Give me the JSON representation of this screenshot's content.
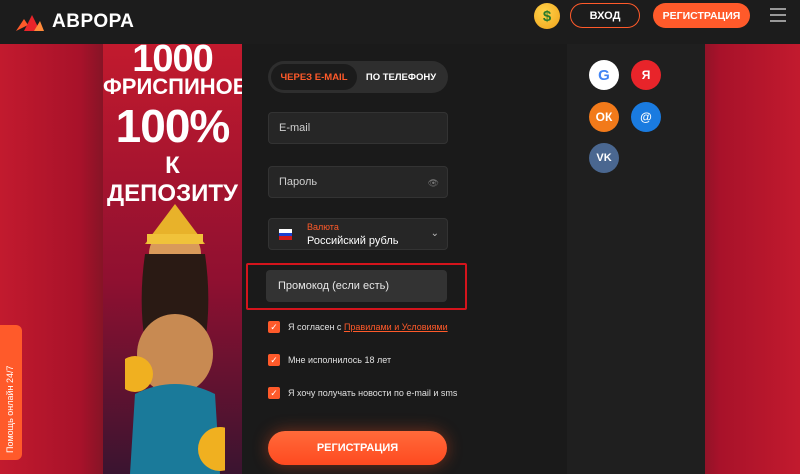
{
  "header": {
    "logo_text": "АВРОРА",
    "login_label": "ВХОД",
    "register_label": "РЕГИСТРАЦИЯ",
    "emoji_icon": "money-face-icon"
  },
  "banner": {
    "line1": "1000",
    "line2": "ФРИСПИНОВ",
    "line3": "100%",
    "line4": "К ДЕПОЗИТУ"
  },
  "form": {
    "tabs": [
      {
        "label": "ЧЕРЕЗ E-MAIL"
      },
      {
        "label": "ПО ТЕЛЕФОНУ"
      }
    ],
    "email_placeholder": "E-mail",
    "password_placeholder": "Пароль",
    "currency_label": "Валюта",
    "currency_value": "Российский рубль",
    "promo_placeholder": "Промокод (если есть)",
    "checks": [
      {
        "text": "Я согласен с ",
        "link": "Правилами и Условиями"
      },
      {
        "text": "Мне исполнилось 18 лет"
      },
      {
        "text": "Я хочу получать новости по e-mail и sms"
      }
    ],
    "submit_label": "РЕГИСТРАЦИЯ"
  },
  "social": {
    "google": "G",
    "yandex": "Я",
    "ok": "ОК",
    "mail": "@",
    "vk": "VK"
  },
  "helper": {
    "label": "Помощь онлайн 24/7"
  },
  "colors": {
    "accent": "#ff5a2a",
    "highlight": "#d4141c",
    "background": "#1a1a1a"
  }
}
